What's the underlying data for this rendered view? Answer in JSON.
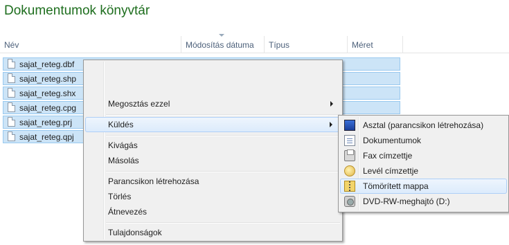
{
  "window": {
    "title": "Dokumentumok könyvtár"
  },
  "columns": [
    "Név",
    "Módosítás dátuma",
    "Típus",
    "Méret"
  ],
  "files": [
    "sajat_reteg.dbf",
    "sajat_reteg.shp",
    "sajat_reteg.shx",
    "sajat_reteg.cpg",
    "sajat_reteg.prj",
    "sajat_reteg.qpj"
  ],
  "context_menu": {
    "share_with": "Megosztás ezzel",
    "send_to": "Küldés",
    "cut": "Kivágás",
    "copy": "Másolás",
    "create_shortcut": "Parancsikon létrehozása",
    "delete": "Törlés",
    "rename": "Átnevezés",
    "properties": "Tulajdonságok"
  },
  "send_to_menu": [
    {
      "label": "Asztal (parancsikon létrehozása)",
      "icon": "desktop-icon"
    },
    {
      "label": "Dokumentumok",
      "icon": "document-icon"
    },
    {
      "label": "Fax címzettje",
      "icon": "fax-icon"
    },
    {
      "label": "Levél címzettje",
      "icon": "mail-icon"
    },
    {
      "label": "Tömörített mappa",
      "icon": "zip-folder-icon"
    },
    {
      "label": "DVD-RW-meghajtó (D:)",
      "icon": "dvd-drive-icon"
    }
  ],
  "highlighted": {
    "main": "Küldés",
    "submenu": "Tömörített mappa"
  }
}
